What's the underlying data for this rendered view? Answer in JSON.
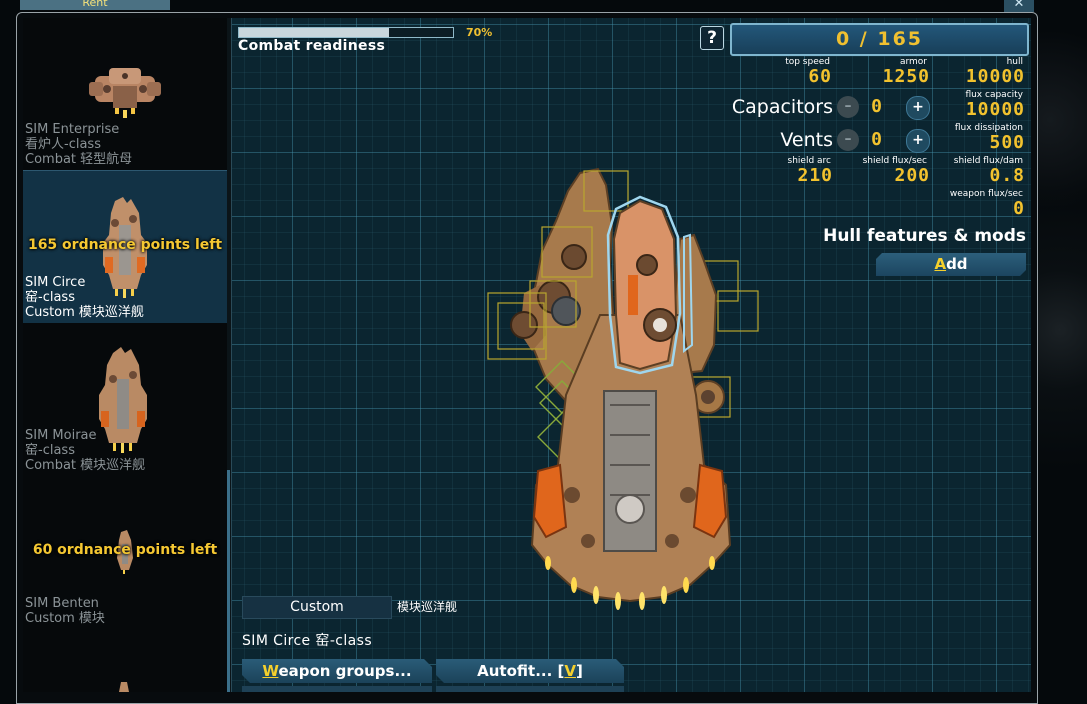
{
  "window": {
    "tab_label": "Rent",
    "close_glyph": "✕"
  },
  "sidebar": {
    "ships": [
      {
        "name": "SIM Enterprise",
        "class": "看炉人-class",
        "variant": "Combat 轻型航母",
        "selected": false,
        "ordnance_left": ""
      },
      {
        "name": "SIM Circe",
        "class": "窑-class",
        "variant": "Custom 模块巡洋舰",
        "selected": true,
        "ordnance_left": "165 ordnance points left"
      },
      {
        "name": "SIM Moirae",
        "class": "窑-class",
        "variant": "Combat 模块巡洋舰",
        "selected": false,
        "ordnance_left": ""
      },
      {
        "name": "SIM Benten",
        "class": "Custom 模块",
        "variant": "",
        "selected": false,
        "ordnance_left": "60 ordnance points left"
      }
    ]
  },
  "readiness": {
    "label": "Combat readiness",
    "percent_text": "70%",
    "value": 0.7
  },
  "help_button": "?",
  "ordnance": {
    "text": "0 / 165",
    "used": 0,
    "total": 165
  },
  "stats": {
    "top_speed": {
      "label": "top speed",
      "value": "60"
    },
    "armor": {
      "label": "armor",
      "value": "1250"
    },
    "hull": {
      "label": "hull",
      "value": "10000"
    },
    "flux_capacity": {
      "label": "flux capacity",
      "value": "10000"
    },
    "flux_dissipation": {
      "label": "flux dissipation",
      "value": "500"
    },
    "shield_arc": {
      "label": "shield arc",
      "value": "210"
    },
    "shield_flux_sec": {
      "label": "shield flux/sec",
      "value": "200"
    },
    "shield_flux_dam": {
      "label": "shield flux/dam",
      "value": "0.8"
    },
    "weapon_flux_sec": {
      "label": "weapon flux/sec",
      "value": "0"
    }
  },
  "capacitors": {
    "label": "Capacitors",
    "value": "0",
    "minus": "–",
    "plus": "+"
  },
  "vents": {
    "label": "Vents",
    "value": "0",
    "minus": "–",
    "plus": "+"
  },
  "hull_mods": {
    "heading": "Hull features & mods",
    "add_hotkey": "A",
    "add_rest": "dd"
  },
  "variant": {
    "name": "Custom",
    "type": "模块巡洋舰"
  },
  "ship_title": "SIM Circe 窑-class",
  "buttons": {
    "weapon_groups_hotkey": "W",
    "weapon_groups_rest": "eapon groups...",
    "autofit_prefix": "Autofit... [",
    "autofit_hotkey": "V",
    "autofit_suffix": "]"
  },
  "colors": {
    "accent_gold": "#f2c22e",
    "panel_blue": "#23577a",
    "grid": "#0b2530"
  }
}
